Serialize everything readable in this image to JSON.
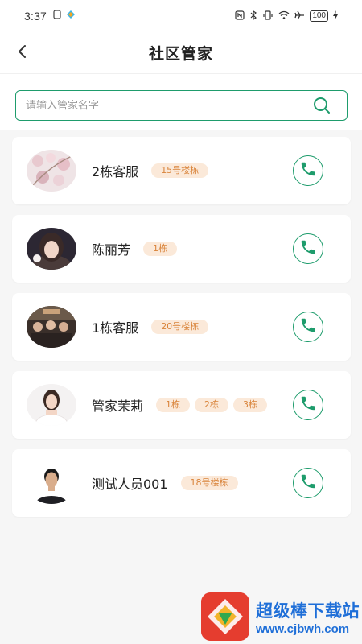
{
  "status_bar": {
    "time": "3:37",
    "battery": "100"
  },
  "header": {
    "title": "社区管家"
  },
  "search": {
    "placeholder": "请输入管家名字",
    "value": ""
  },
  "managers": [
    {
      "name": "2栋客服",
      "tags": [
        "15号楼栋"
      ]
    },
    {
      "name": "陈丽芳",
      "tags": [
        "1栋"
      ]
    },
    {
      "name": "1栋客服",
      "tags": [
        "20号楼栋"
      ]
    },
    {
      "name": "管家茉莉",
      "tags": [
        "1栋",
        "2栋",
        "3栋"
      ]
    },
    {
      "name": "测试人员001",
      "tags": [
        "18号楼栋"
      ]
    }
  ],
  "watermark": {
    "title": "超级棒下载站",
    "url": "www.cjbwh.com"
  },
  "colors": {
    "accent": "#1e9c6c",
    "tag_bg": "#fbe9d9",
    "tag_text": "#d9843b"
  },
  "icons": {
    "back": "chevron-left-icon",
    "search": "search-icon",
    "call": "phone-icon"
  }
}
